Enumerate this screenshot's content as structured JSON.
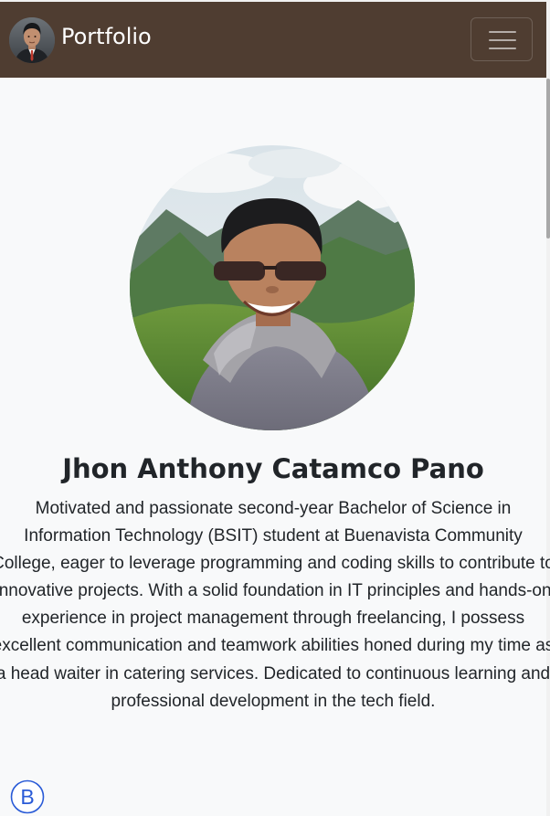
{
  "navbar": {
    "brand": "Portfolio",
    "toggle_icon": "hamburger-menu-icon",
    "background": "#4f3d31"
  },
  "profile": {
    "name": "Jhon Anthony Catamco Pano",
    "bio": "Motivated and passionate second-year Bachelor of Science in Information Technology (BSIT) student at Buenavista Community College, eager to leverage programming and coding skills to contribute to innovative projects. With a solid foundation in IT principles and hands-on experience in project management through freelancing, I possess excellent communication and teamwork abilities honed during my time as a head waiter in catering services. Dedicated to continuous learning and professional development in the tech field."
  },
  "footer": {
    "logo_icon": "bootstrap-logo-icon",
    "logo_letter": "B",
    "logo_color": "#2a5bd7"
  }
}
